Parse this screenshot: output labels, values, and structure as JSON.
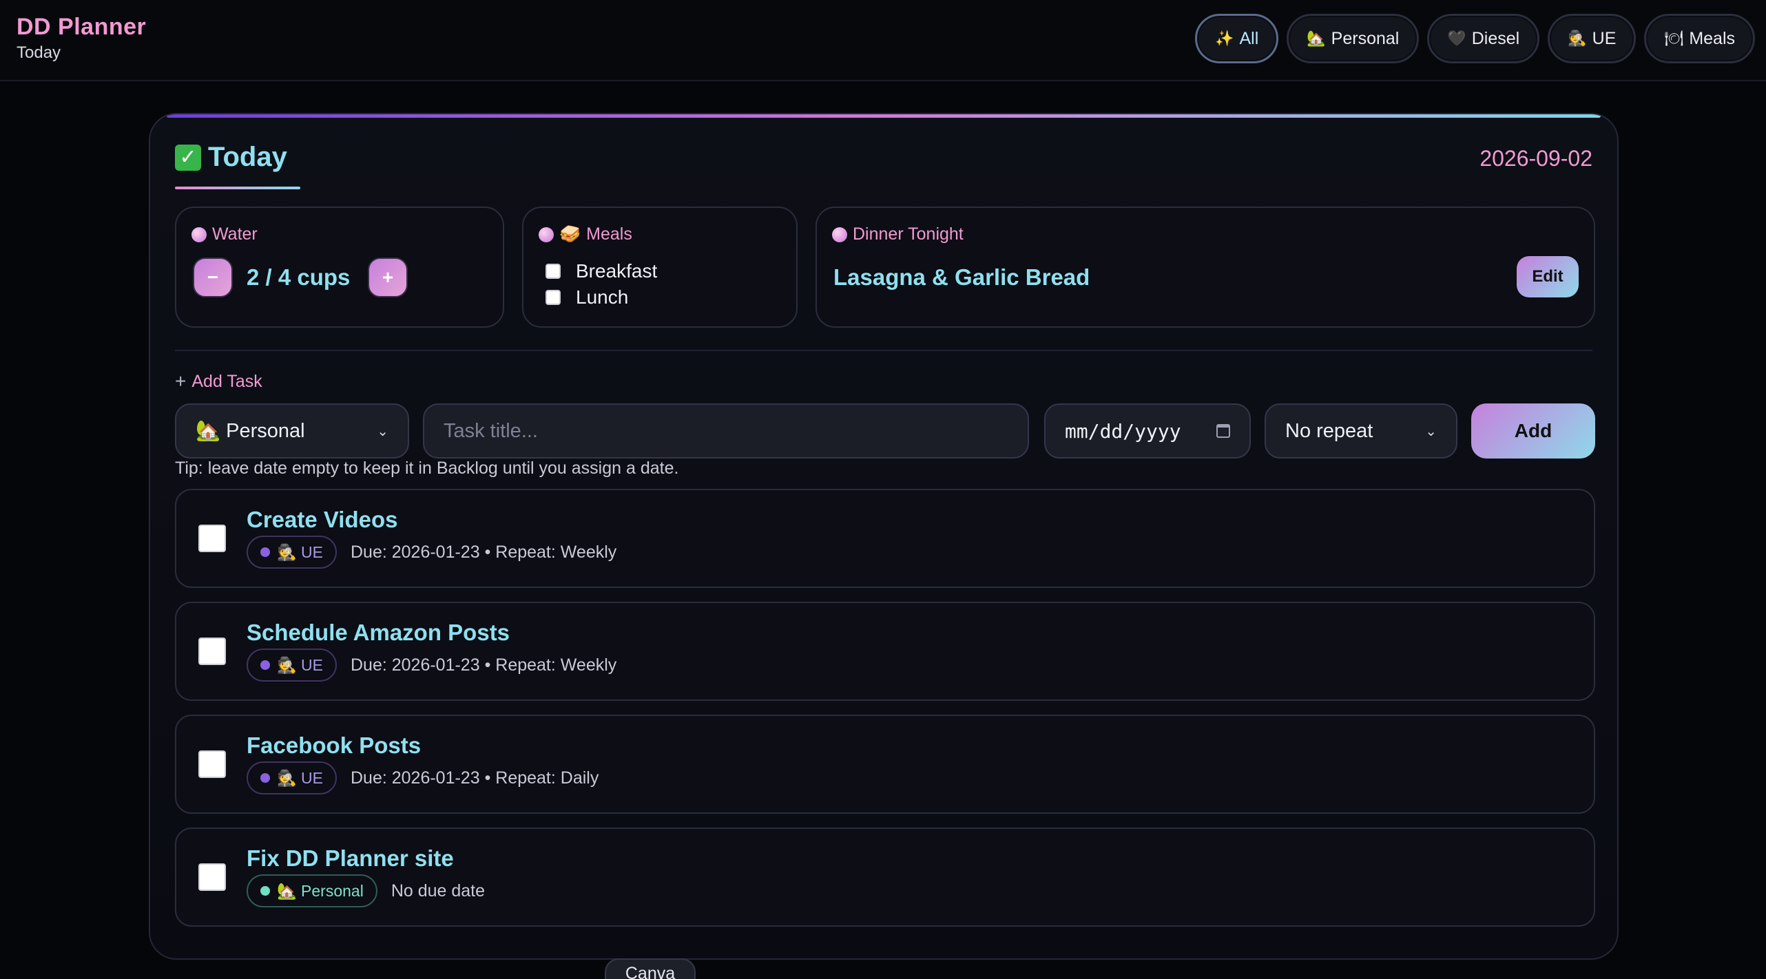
{
  "app": {
    "title": "DD Planner",
    "subtitle": "Today"
  },
  "filters": [
    {
      "icon": "✨",
      "label": "All"
    },
    {
      "icon": "🏡",
      "label": "Personal"
    },
    {
      "icon": "🖤",
      "label": "Diesel"
    },
    {
      "icon": "🕵",
      "label": "UE"
    },
    {
      "icon": "🍽",
      "label": "Meals"
    }
  ],
  "card": {
    "title": "Today",
    "date": "2026-09-02"
  },
  "water": {
    "label": "Water",
    "count": "2 / 4 cups",
    "minus": "−",
    "plus": "+"
  },
  "meals": {
    "label": "Meals",
    "items": [
      "Breakfast",
      "Lunch"
    ]
  },
  "dinner": {
    "label": "Dinner Tonight",
    "name": "Lasagna & Garlic Bread",
    "edit_label": "Edit"
  },
  "add_task": {
    "label": "Add Task",
    "category": "🏡 Personal",
    "title_placeholder": "Task title...",
    "date_placeholder": "mm/dd/yyyy",
    "repeat": "No repeat",
    "add_label": "Add",
    "tip": "Tip: leave date empty to keep it in Backlog until you assign a date."
  },
  "tasks": [
    {
      "title": "Create Videos",
      "tag": "🕵 UE",
      "meta": "Due: 2026-01-23 • Repeat: Weekly"
    },
    {
      "title": "Schedule Amazon Posts",
      "tag": "🕵 UE",
      "meta": "Due: 2026-01-23 • Repeat: Weekly"
    },
    {
      "title": "Facebook Posts",
      "tag": "🕵 UE",
      "meta": "Due: 2026-01-23 • Repeat: Daily"
    },
    {
      "title": "Fix DD Planner site",
      "tag": "🏡 Personal",
      "meta": "No due date"
    }
  ],
  "tab": {
    "label": "Canva"
  },
  "colors": {
    "accent_pink": "#f29ad2",
    "accent_cyan": "#8fe0ef",
    "ue_tag": "#8a62e0",
    "personal_tag": "#6fe0c0"
  }
}
